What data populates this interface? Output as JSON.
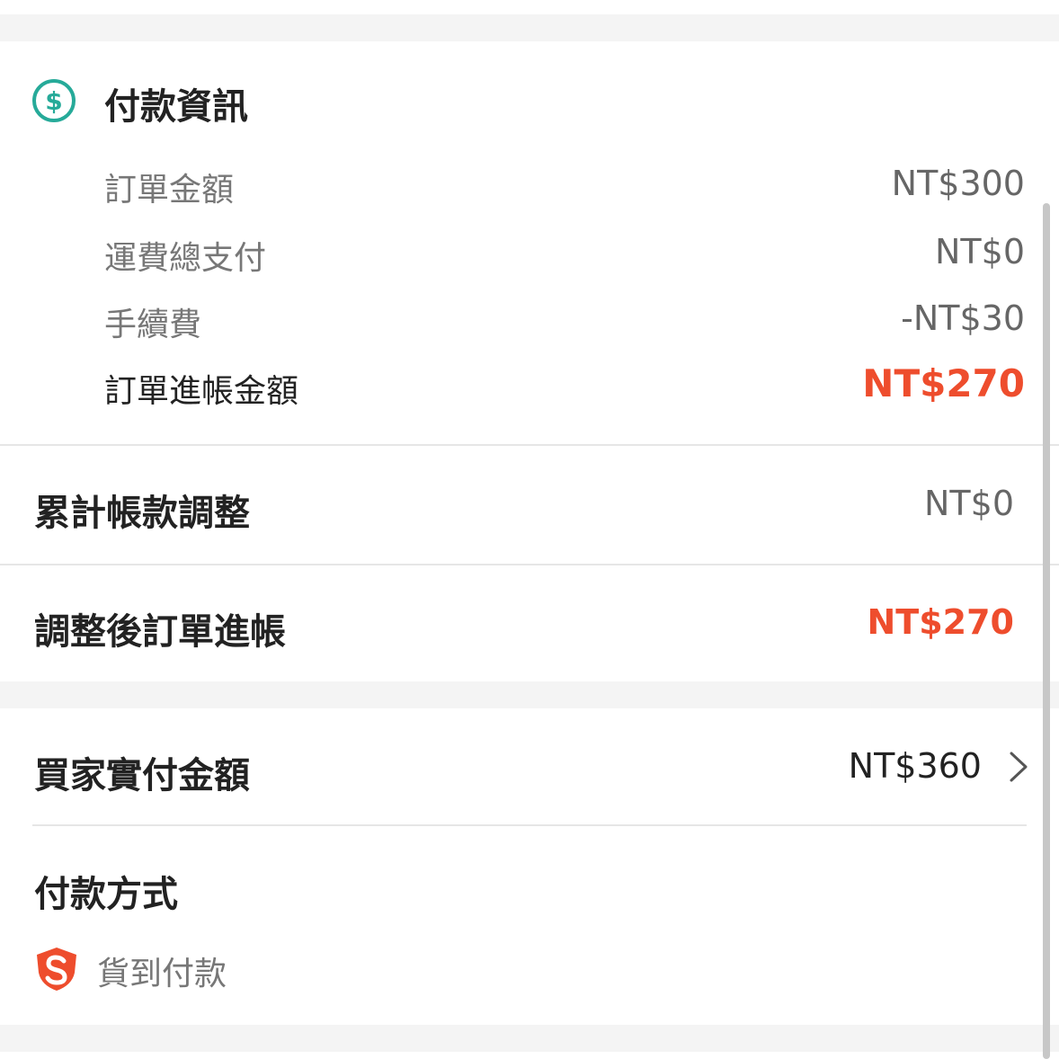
{
  "payment_info": {
    "title": "付款資訊",
    "icon": "dollar-circle-icon",
    "rows": [
      {
        "label": "訂單金額",
        "value": "NT$300"
      },
      {
        "label": "運費總支付",
        "value": "NT$0"
      },
      {
        "label": "手續費",
        "value": "-NT$30"
      },
      {
        "label": "訂單進帳金額",
        "value": "NT$270"
      }
    ]
  },
  "adjustment": {
    "label": "累計帳款調整",
    "value": "NT$0"
  },
  "adjusted_income": {
    "label": "調整後訂單進帳",
    "value": "NT$270"
  },
  "buyer_paid": {
    "label": "買家實付金額",
    "value": "NT$360",
    "icon": "chevron-right-icon"
  },
  "payment_method": {
    "title": "付款方式",
    "method": "貨到付款",
    "icon": "shopee-shield-icon"
  },
  "colors": {
    "accent": "#ee4d2d",
    "teal": "#26aa99",
    "background_gap": "#f4f4f4"
  }
}
